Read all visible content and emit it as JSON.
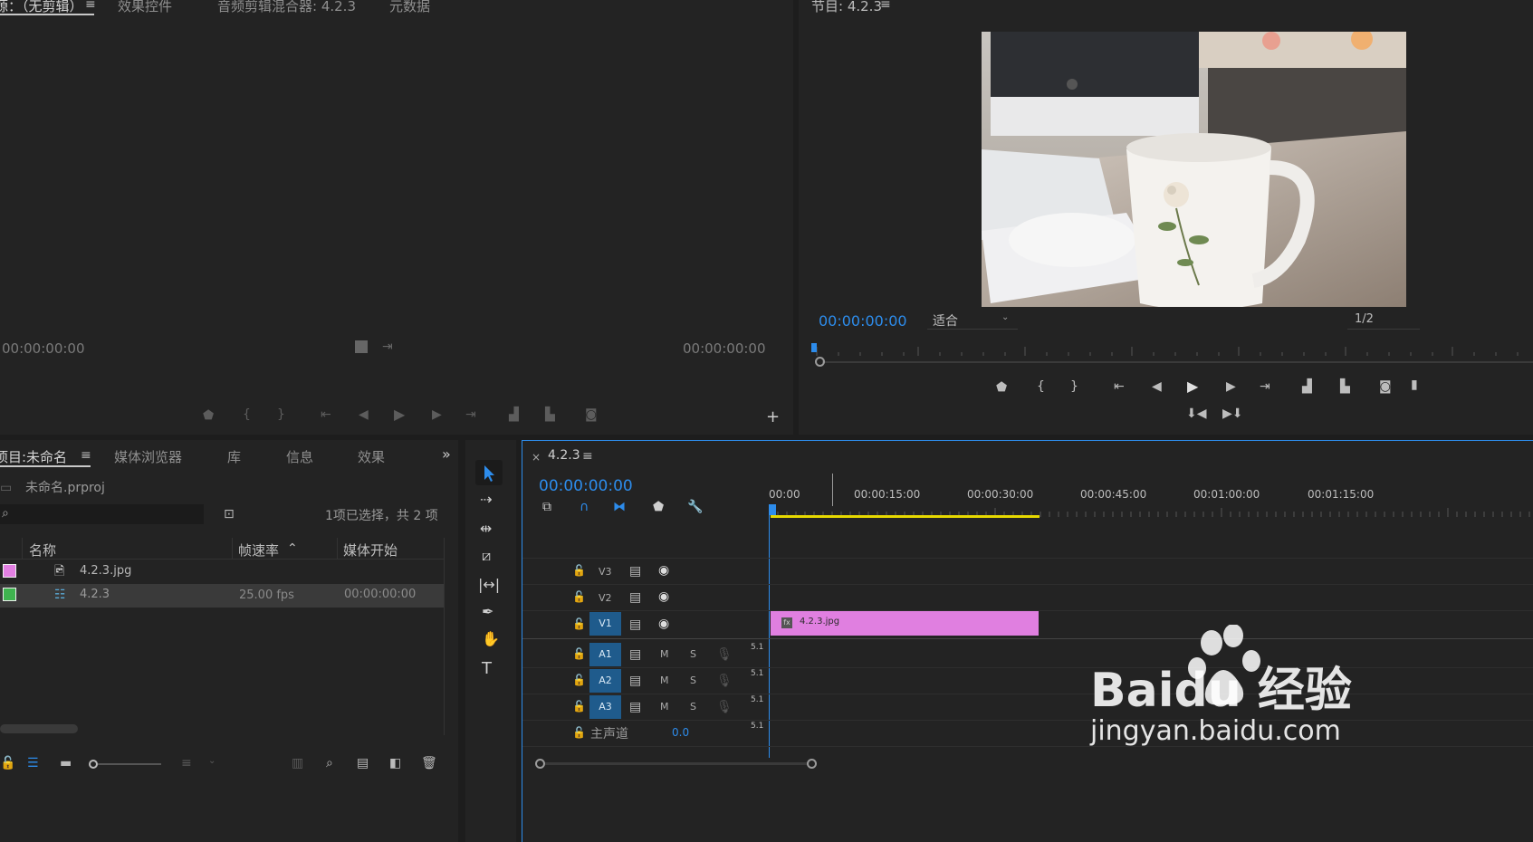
{
  "source_panel": {
    "tabs": [
      "源：（无剪辑）",
      "效果控件",
      "音频剪辑混合器: 4.2.3",
      "元数据"
    ],
    "timecode_left": "00:00:00:00",
    "timecode_right": "00:00:00:00"
  },
  "program_panel": {
    "title": "节目: 4.2.3",
    "timecode": "00:00:00:00",
    "fit": "适合",
    "resolution": "1/2"
  },
  "project_panel": {
    "tabs": [
      "项目:未命名",
      "媒体浏览器",
      "库",
      "信息",
      "效果"
    ],
    "filename": "未命名.prproj",
    "selection_info": "1项已选择，共 2 项",
    "columns": [
      "名称",
      "帧速率",
      "媒体开始"
    ],
    "items": [
      {
        "name": "4.2.3.jpg",
        "fps": "",
        "start": "",
        "color": "#e27fe2"
      },
      {
        "name": "4.2.3",
        "fps": "25.00 fps",
        "start": "00:00:00:00",
        "color": "#3fb34f"
      }
    ]
  },
  "timeline": {
    "title": "4.2.3",
    "timecode": "00:00:00:00",
    "ruler": [
      "00:00",
      "00:00:15:00",
      "00:00:30:00",
      "00:00:45:00",
      "00:01:00:00",
      "00:01:15:00"
    ],
    "tracks_video": [
      "V3",
      "V2",
      "V1"
    ],
    "tracks_audio": [
      "A1",
      "A2",
      "A3"
    ],
    "master_label": "主声道",
    "master_value": "0.0",
    "channel": "5.1",
    "clip_name": "4.2.3.jpg",
    "clip_color": "#e07fe0",
    "m_label": "M",
    "s_label": "S"
  },
  "watermark": {
    "brand": "Baidu 经验",
    "url": "jingyan.baidu.com"
  }
}
